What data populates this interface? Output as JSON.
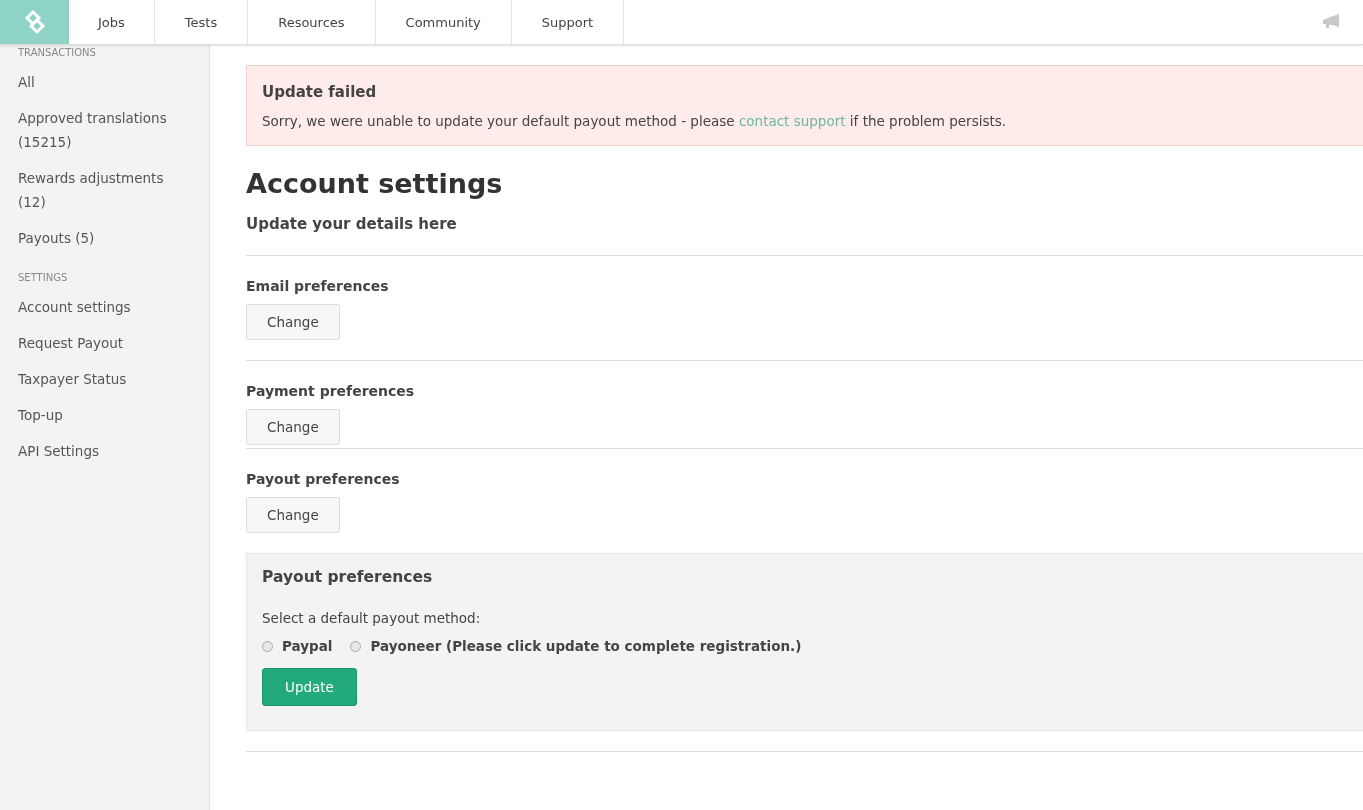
{
  "nav": {
    "items": [
      {
        "label": "Jobs",
        "selected": false
      },
      {
        "label": "Tests",
        "selected": false
      },
      {
        "label": "Resources",
        "selected": false
      },
      {
        "label": "Community",
        "selected": false
      },
      {
        "label": "Support",
        "selected": false
      }
    ]
  },
  "sidebar": {
    "sections": [
      {
        "heading": "TRANSACTIONS",
        "items": [
          {
            "label": "All",
            "selected": false
          },
          {
            "label": "Approved translations (15215)",
            "selected": false
          },
          {
            "label": "Rewards adjustments (12)",
            "selected": false
          },
          {
            "label": "Payouts (5)",
            "selected": false
          }
        ]
      },
      {
        "heading": "SETTINGS",
        "items": [
          {
            "label": "Account settings",
            "selected": false
          },
          {
            "label": "Request Payout",
            "selected": false
          },
          {
            "label": "Taxpayer Status",
            "selected": false
          },
          {
            "label": "Top-up",
            "selected": false
          },
          {
            "label": "API Settings",
            "selected": false
          }
        ]
      }
    ]
  },
  "alert": {
    "title": "Update failed",
    "before": "Sorry, we were unable to update your default payout method - please",
    "link": "contact support",
    "after": "if the problem persists."
  },
  "page": {
    "title": "Account settings",
    "subtitle": "Update your details here"
  },
  "sections": [
    {
      "title": "Email preferences",
      "button": "Change"
    },
    {
      "title": "Payment preferences",
      "button": "Change"
    },
    {
      "title": "Payout preferences",
      "button": "Change"
    }
  ],
  "payout_panel": {
    "title": "Payout preferences",
    "prompt": "Select a default payout method:",
    "options": [
      {
        "label": "Paypal",
        "selected": false
      },
      {
        "label": "Payoneer (Please click update to complete registration.)",
        "selected": false
      }
    ],
    "button": "Update"
  }
}
